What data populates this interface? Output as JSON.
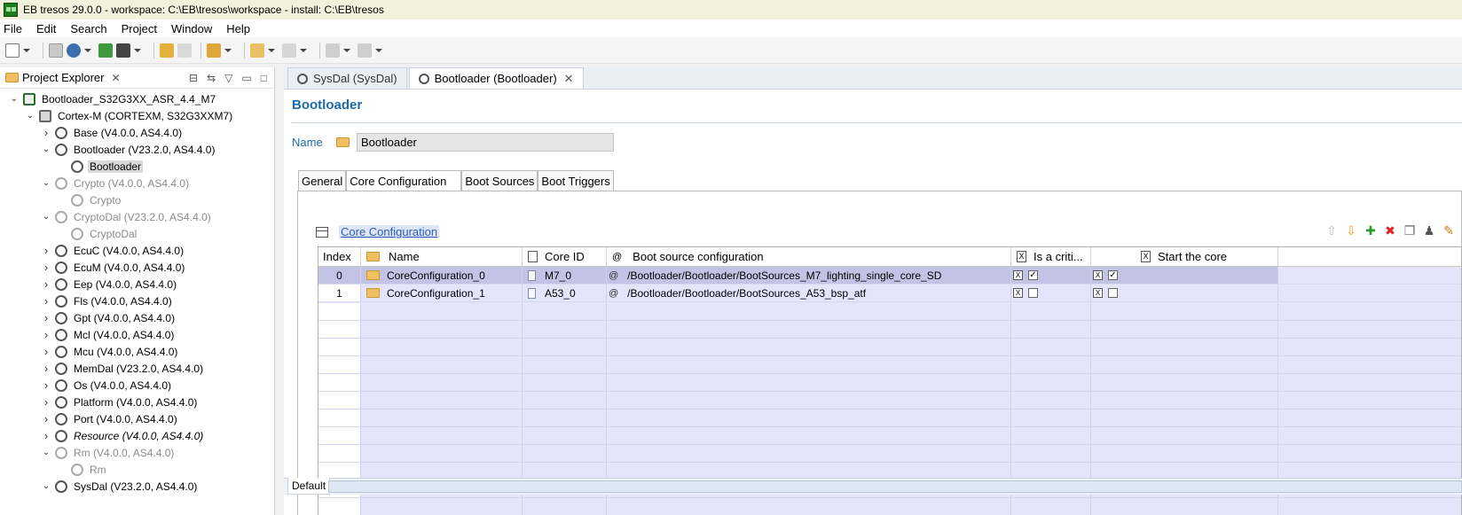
{
  "window": {
    "title": "EB tresos 29.0.0 - workspace: C:\\EB\\tresos\\workspace - install: C:\\EB\\tresos"
  },
  "menu": [
    "File",
    "Edit",
    "Search",
    "Project",
    "Window",
    "Help"
  ],
  "explorer": {
    "title": "Project Explorer",
    "tree": [
      {
        "label": "Bootloader_S32G3XX_ASR_4.4_M7",
        "depth": 0,
        "expanded": true,
        "kind": "proj"
      },
      {
        "label": "Cortex-M (CORTEXM, S32G3XXM7)",
        "depth": 1,
        "expanded": true,
        "kind": "cpu"
      },
      {
        "label": "Base (V4.0.0, AS4.4.0)",
        "depth": 2,
        "expanded": false,
        "kind": "mod"
      },
      {
        "label": "Bootloader (V23.2.0, AS4.4.0)",
        "depth": 2,
        "expanded": true,
        "kind": "mod"
      },
      {
        "label": "Bootloader",
        "depth": 3,
        "kind": "cfg",
        "selected": true
      },
      {
        "label": "Crypto (V4.0.0, AS4.4.0)",
        "depth": 2,
        "expanded": true,
        "kind": "mod",
        "dim": true
      },
      {
        "label": "Crypto",
        "depth": 3,
        "kind": "cfg",
        "dim": true
      },
      {
        "label": "CryptoDal (V23.2.0, AS4.4.0)",
        "depth": 2,
        "expanded": true,
        "kind": "mod",
        "dim": true
      },
      {
        "label": "CryptoDal",
        "depth": 3,
        "kind": "cfg",
        "dim": true
      },
      {
        "label": "EcuC (V4.0.0, AS4.4.0)",
        "depth": 2,
        "expanded": false,
        "kind": "mod"
      },
      {
        "label": "EcuM (V4.0.0, AS4.4.0)",
        "depth": 2,
        "expanded": false,
        "kind": "mod"
      },
      {
        "label": "Eep (V4.0.0, AS4.4.0)",
        "depth": 2,
        "expanded": false,
        "kind": "mod"
      },
      {
        "label": "Fls (V4.0.0, AS4.4.0)",
        "depth": 2,
        "expanded": false,
        "kind": "mod"
      },
      {
        "label": "Gpt (V4.0.0, AS4.4.0)",
        "depth": 2,
        "expanded": false,
        "kind": "mod"
      },
      {
        "label": "Mcl (V4.0.0, AS4.4.0)",
        "depth": 2,
        "expanded": false,
        "kind": "mod"
      },
      {
        "label": "Mcu (V4.0.0, AS4.4.0)",
        "depth": 2,
        "expanded": false,
        "kind": "mod"
      },
      {
        "label": "MemDal (V23.2.0, AS4.4.0)",
        "depth": 2,
        "expanded": false,
        "kind": "mod"
      },
      {
        "label": "Os (V4.0.0, AS4.4.0)",
        "depth": 2,
        "expanded": false,
        "kind": "mod"
      },
      {
        "label": "Platform (V4.0.0, AS4.4.0)",
        "depth": 2,
        "expanded": false,
        "kind": "mod"
      },
      {
        "label": "Port (V4.0.0, AS4.4.0)",
        "depth": 2,
        "expanded": false,
        "kind": "mod"
      },
      {
        "label": "Resource (V4.0.0, AS4.4.0)",
        "depth": 2,
        "expanded": false,
        "kind": "mod",
        "italic": true
      },
      {
        "label": "Rm (V4.0.0, AS4.4.0)",
        "depth": 2,
        "expanded": true,
        "kind": "mod",
        "dim": true
      },
      {
        "label": "Rm",
        "depth": 3,
        "kind": "cfg",
        "dim": true
      },
      {
        "label": "SysDal (V23.2.0, AS4.4.0)",
        "depth": 2,
        "expanded": true,
        "kind": "mod"
      }
    ]
  },
  "editor": {
    "tabs": [
      {
        "label": "SysDal (SysDal)",
        "active": false
      },
      {
        "label": "Bootloader (Bootloader)",
        "active": true
      }
    ],
    "title": "Bootloader",
    "name_label": "Name",
    "name_value": "Bootloader",
    "sub_tabs": [
      "General",
      "Core Configuration",
      "Boot Sources",
      "Boot Triggers"
    ],
    "active_sub_tab": "Core Configuration",
    "section_title": "Core Configuration",
    "bottom_tab": "Default"
  },
  "table": {
    "headers": [
      "Index",
      "Name",
      "Core ID",
      "Boot source configuration",
      "Is a criti...",
      "Start the core"
    ],
    "rows": [
      {
        "index": "0",
        "name": "CoreConfiguration_0",
        "core_id": "M7_0",
        "boot_source": "/Bootloader/Bootloader/BootSources_M7_lighting_single_core_SD",
        "critical": true,
        "start": true
      },
      {
        "index": "1",
        "name": "CoreConfiguration_1",
        "core_id": "A53_0",
        "boot_source": "/Bootloader/Bootloader/BootSources_A53_bsp_atf",
        "critical": false,
        "start": false
      }
    ]
  },
  "colors": {
    "accent": "#1a6ca8",
    "selection": "#c3c3e6",
    "table_bg": "#e4e4fb"
  }
}
